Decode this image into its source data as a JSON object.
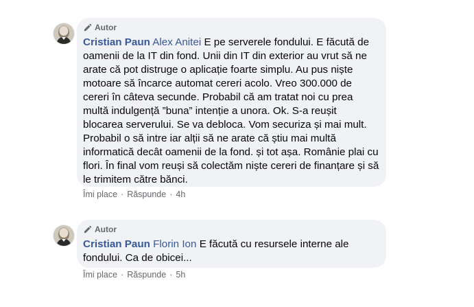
{
  "comments": [
    {
      "badge": "Autor",
      "author": "Cristian Paun",
      "mention": "Alex Anitei",
      "text": "E pe serverele fondului. E făcută de oamenii de la IT din fond. Unii din IT din exterior au vrut să ne arate că pot distruge o aplicație foarte simplu. Au pus niște motoare să încarce automat cereri acolo. Vreo 300.000 de cereri în câteva secunde. Probabil că am tratat noi cu prea multă indulgență ”buna” intenție a unora. Ok. S-a reușit blocarea serverului. Se va debloca. Vom securiza și mai mult. Probabil o să intre iar alții să ne arate că știu mai multă informatică decât oamenii de la fond. și tot așa. Românie plai cu flori. În final vom reuși să colectăm niște cereri de finanțare și să le trimitem către bănci.",
      "like_label": "Îmi place",
      "reply_label": "Răspunde",
      "time": "4h"
    },
    {
      "badge": "Autor",
      "author": "Cristian Paun",
      "mention": "Florin Ion",
      "text": "E făcută cu resursele interne ale fondului. Ca de obicei...",
      "like_label": "Îmi place",
      "reply_label": "Răspunde",
      "time": "5h"
    }
  ],
  "separator": "·",
  "colors": {
    "bubble": "#f0f2f5",
    "name": "#385898",
    "meta": "#65676b",
    "text": "#050505"
  },
  "icons": {
    "badge": "pencil-icon",
    "avatar": "profile-photo"
  }
}
